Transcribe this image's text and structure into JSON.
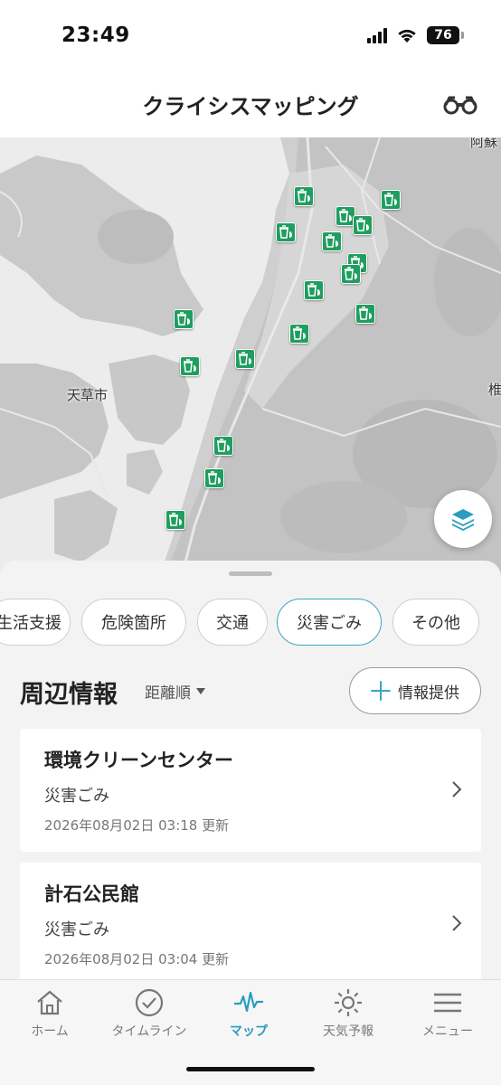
{
  "status_bar": {
    "time": "23:49",
    "battery": "76"
  },
  "header": {
    "title": "クライシスマッピング",
    "icon": "binoculars-icon"
  },
  "map": {
    "labels": [
      "天草市",
      "阿蘇",
      "椎"
    ],
    "marker_icon": "trash-bin-icon",
    "marker_color": "#1f9e5f",
    "layer_button_icon": "layers-icon"
  },
  "chips": [
    {
      "label": "生活支援"
    },
    {
      "label": "危険箇所"
    },
    {
      "label": "交通"
    },
    {
      "label": "災害ごみ",
      "active": true
    },
    {
      "label": "その他"
    }
  ],
  "section": {
    "title": "周辺情報",
    "sort_label": "距離順",
    "provide_label": "情報提供"
  },
  "cards": [
    {
      "title": "環境クリーンセンター",
      "category": "災害ごみ",
      "updated": "2026年08月02日 03:18 更新"
    },
    {
      "title": "計石公民館",
      "category": "災害ごみ",
      "updated": "2026年08月02日 03:04 更新"
    }
  ],
  "tabs": [
    {
      "label": "ホーム",
      "icon": "home-icon"
    },
    {
      "label": "タイムライン",
      "icon": "check-circle-icon"
    },
    {
      "label": "マップ",
      "icon": "pulse-icon",
      "active": true
    },
    {
      "label": "天気予報",
      "icon": "sun-icon"
    },
    {
      "label": "メニュー",
      "icon": "menu-icon"
    }
  ],
  "colors": {
    "accent": "#2a9cbf",
    "chip_active_border": "#3aa6c3",
    "marker": "#1f9e5f"
  }
}
